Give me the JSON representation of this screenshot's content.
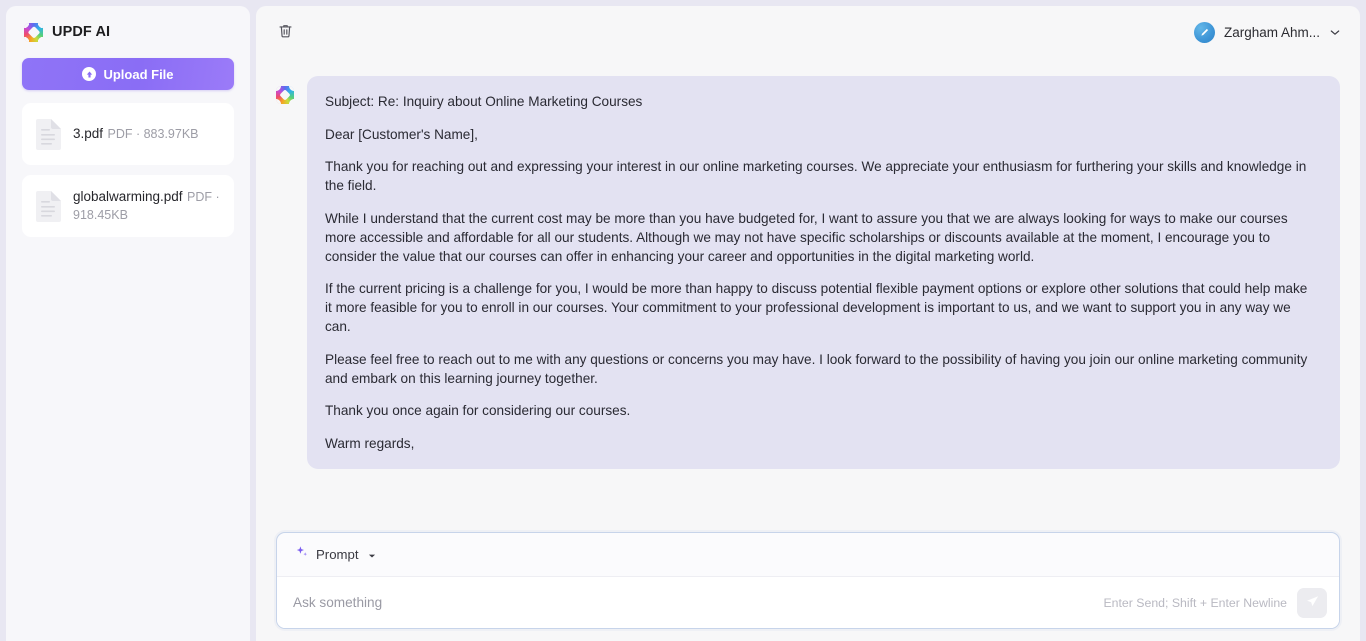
{
  "sidebar": {
    "brand": {
      "name": "UPDF AI",
      "logo_icon": "updf-clover-logo-icon"
    },
    "upload": {
      "label": "Upload File",
      "icon": "upload-arrow-icon"
    },
    "files": [
      {
        "name": "3.pdf",
        "meta": "PDF · 883.97KB",
        "icon": "pdf-document-icon"
      },
      {
        "name": "globalwarming.pdf",
        "meta": "PDF · 918.45KB",
        "icon": "pdf-document-icon"
      }
    ]
  },
  "topbar": {
    "delete_icon": "trash-icon",
    "user": {
      "name": "Zargham Ahm...",
      "avatar_icon": "user-avatar-pen-icon",
      "caret_icon": "chevron-down-icon"
    }
  },
  "message": {
    "avatar_icon": "updf-clover-logo-icon",
    "paragraphs": [
      "Subject: Re: Inquiry about Online Marketing Courses",
      "Dear [Customer's Name],",
      "Thank you for reaching out and expressing your interest in our online marketing courses. We appreciate your enthusiasm for furthering your skills and knowledge in the field.",
      "While I understand that the current cost may be more than you have budgeted for, I want to assure you that we are always looking for ways to make our courses more accessible and affordable for all our students. Although we may not have specific scholarships or discounts available at the moment, I encourage you to consider the value that our courses can offer in enhancing your career and opportunities in the digital marketing world.",
      "If the current pricing is a challenge for you, I would be more than happy to discuss potential flexible payment options or explore other solutions that could help make it more feasible for you to enroll in our courses. Your commitment to your professional development is important to us, and we want to support you in any way we can.",
      "Please feel free to reach out to me with any questions or concerns you may have. I look forward to the possibility of having you join our online marketing community and embark on this learning journey together.",
      "Thank you once again for considering our courses.",
      "Warm regards,"
    ]
  },
  "composer": {
    "mode_label": "Prompt",
    "mode_icon": "sparkle-icon",
    "mode_caret_icon": "caret-down-icon",
    "input_value": "",
    "input_placeholder": "Ask something",
    "hint": "Enter Send; Shift + Enter Newline",
    "send_icon": "send-paper-plane-icon"
  },
  "colors": {
    "page_bg": "#e8e7f2",
    "panel_bg": "#f7f7f8",
    "accent_purple": "#8a6df5",
    "bubble_bg": "#e3e2f2",
    "avatar_blue": "#3d94d6"
  }
}
